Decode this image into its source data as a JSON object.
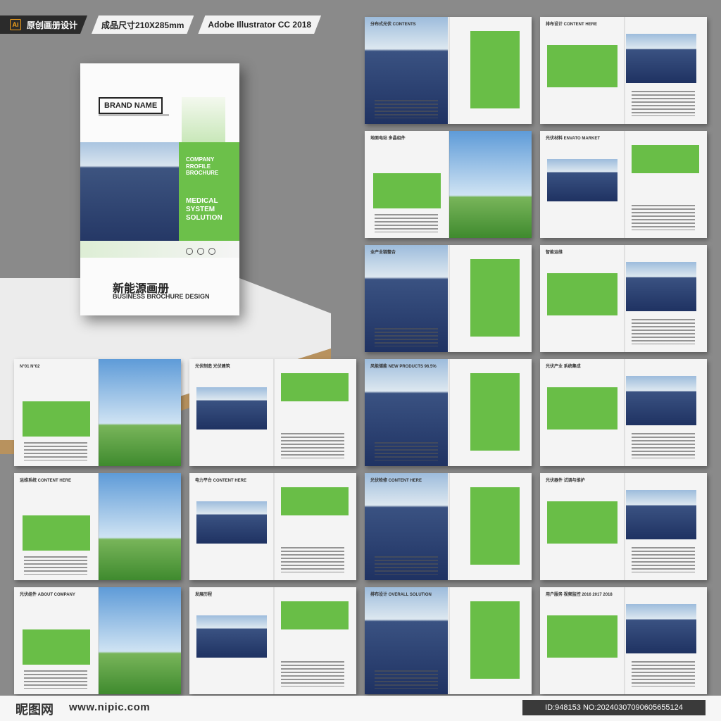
{
  "header": {
    "ai_badge": "Ai",
    "title": "原创画册设计",
    "size": "成品尺寸210X285mm",
    "software": "Adobe Illustrator CC 2018"
  },
  "cover": {
    "brand": "BRAND NAME",
    "company_lines": "COMPANY RROFILE BROCHURE",
    "solution": "MEDICAL SYSTEM SOLUTION",
    "title_zh": "新能源画册",
    "title_en": "BUSINESS BROCHURE DESIGN"
  },
  "spreads": [
    {
      "label": "分布式光伏 CONTENTS"
    },
    {
      "label": "排布设计 CONTENT HERE"
    },
    {
      "label": "地面电站 多晶组件"
    },
    {
      "label": "光伏材料 ENVATO MARKET"
    },
    {
      "label": "全产业链整合"
    },
    {
      "label": "智能运维"
    },
    {
      "label": "N°01 N°02"
    },
    {
      "label": "光伏制造 光伏建筑"
    },
    {
      "label": "风能储能 NEW PRODUCTS 96.5%"
    },
    {
      "label": "光伏产业 系统集成"
    },
    {
      "label": "运维系统 CONTENT HERE"
    },
    {
      "label": "电力平台 CONTENT HERE"
    },
    {
      "label": "光伏检修 CONTENT HERE"
    },
    {
      "label": "光伏器件 试调与维护"
    },
    {
      "label": "光伏组件 ABOUT COMPANY"
    },
    {
      "label": "发展历程"
    },
    {
      "label": "排布设计 OVERALL SOLUTION"
    },
    {
      "label": "用户服务 视频监控 2016 2017 2018"
    }
  ],
  "footer": {
    "logo": "昵图网",
    "site": "www.nipic.com",
    "id": "ID:948153 NO:20240307090605655124"
  }
}
